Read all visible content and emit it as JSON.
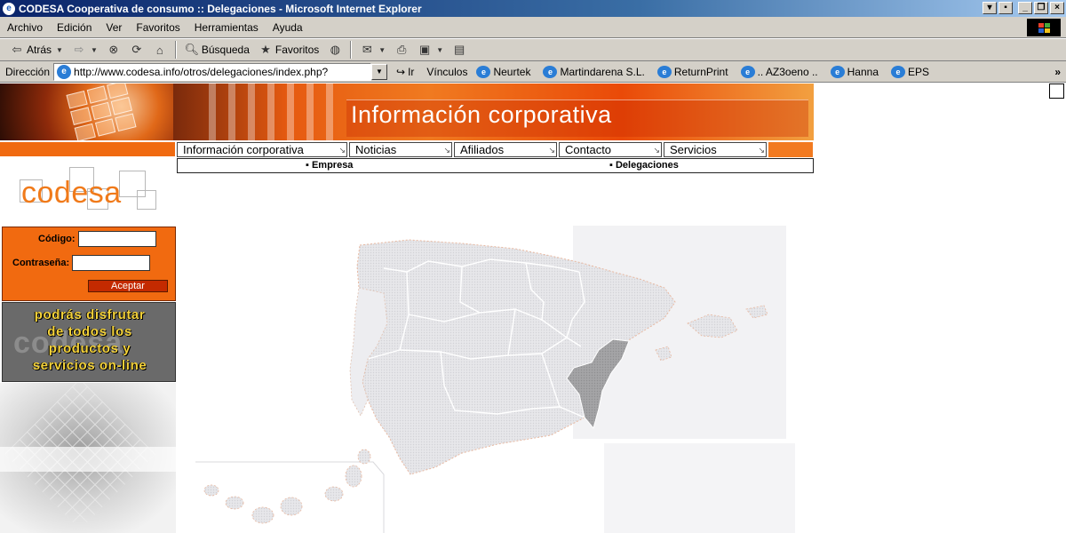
{
  "window": {
    "title": "CODESA Cooperativa de consumo :: Delegaciones - Microsoft Internet Explorer"
  },
  "menu": [
    "Archivo",
    "Edición",
    "Ver",
    "Favoritos",
    "Herramientas",
    "Ayuda"
  ],
  "toolbar": {
    "back": "Atrás",
    "search": "Búsqueda",
    "favorites": "Favoritos"
  },
  "address": {
    "label": "Dirección",
    "url": "http://www.codesa.info/otros/delegaciones/index.php?",
    "go": "Ir"
  },
  "links": {
    "label": "Vínculos",
    "items": [
      "Neurtek",
      "Martindarena S.L.",
      "ReturnPrint",
      ".. AZ3oeno ..",
      "Hanna",
      "EPS"
    ]
  },
  "banner": {
    "title": "Información corporativa"
  },
  "nav": {
    "tabs": [
      "Información corporativa",
      "Noticias",
      "Afiliados",
      "Contacto",
      "Servicios"
    ],
    "sub": [
      "▪ Empresa",
      "▪ Delegaciones"
    ]
  },
  "logo": {
    "text": "codesa"
  },
  "login": {
    "code_label": "Código:",
    "password_label": "Contraseña:",
    "submit": "Aceptar"
  },
  "promo": {
    "lines": [
      "podrás disfrutar",
      "de todos los",
      "productos y",
      "servicios on-line"
    ],
    "watermark": "codesa"
  },
  "colors": {
    "brand_orange": "#f07a1a",
    "highlight_region": "#a8a8a8",
    "map_base": "#e8e8ea"
  }
}
